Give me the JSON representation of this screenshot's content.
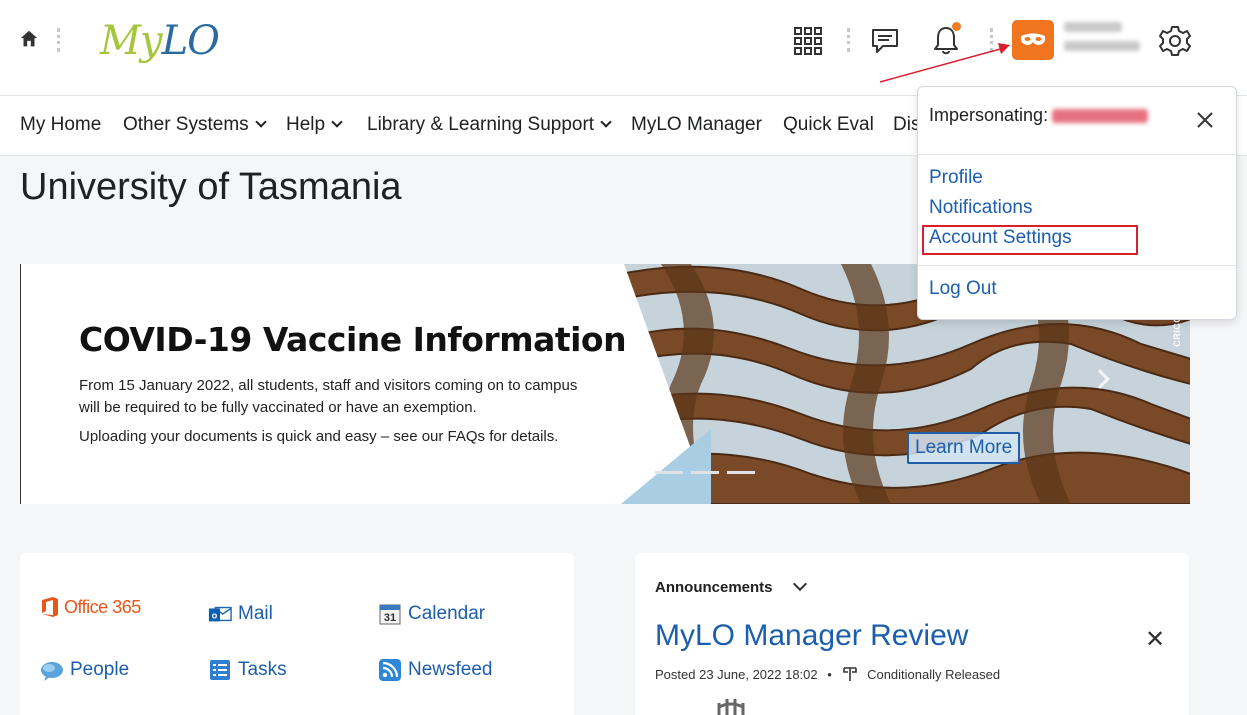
{
  "header": {
    "logo_my": "My",
    "logo_lo": "LO"
  },
  "nav": {
    "items": [
      {
        "label": "My Home",
        "dropdown": false
      },
      {
        "label": "Other Systems",
        "dropdown": true
      },
      {
        "label": "Help",
        "dropdown": true
      },
      {
        "label": "Library & Learning Support",
        "dropdown": true
      },
      {
        "label": "MyLO Manager",
        "dropdown": false
      },
      {
        "label": "Quick Eval",
        "dropdown": false
      },
      {
        "label": "Dis",
        "dropdown": false
      }
    ]
  },
  "page": {
    "title": "University of Tasmania"
  },
  "banner": {
    "heading": "COVID-19 Vaccine Information",
    "para1_prefix": "From ",
    "para1_date": "15 January 2022",
    "para1_rest": ", all students, staff and visitors coming on to campus will be required to be fully vaccinated or have an exemption.",
    "para2": "Uploading your documents is quick and easy – see our FAQs for details.",
    "button": "Learn More",
    "side_text": "CRICO"
  },
  "quicklinks": {
    "items": [
      {
        "label": "Office 365",
        "icon": "office365-icon"
      },
      {
        "label": "Mail",
        "icon": "outlook-mail-icon"
      },
      {
        "label": "Calendar",
        "icon": "calendar-icon"
      },
      {
        "label": "People",
        "icon": "people-icon"
      },
      {
        "label": "Tasks",
        "icon": "tasks-icon"
      },
      {
        "label": "Newsfeed",
        "icon": "rss-icon"
      }
    ]
  },
  "announcements": {
    "heading": "Announcements",
    "title": "MyLO Manager Review",
    "posted": "Posted 23 June, 2022 18:02",
    "separator": "•",
    "status": "Conditionally Released"
  },
  "dropdown": {
    "impersonating_label": "Impersonating:",
    "links": [
      "Profile",
      "Notifications",
      "Account Settings",
      "Log Out"
    ]
  },
  "colors": {
    "link": "#1c5eae",
    "accent_orange": "#f0751e",
    "annotation_red": "#d62030",
    "logo_green": "#a4c639",
    "logo_blue": "#2b6aa0"
  }
}
